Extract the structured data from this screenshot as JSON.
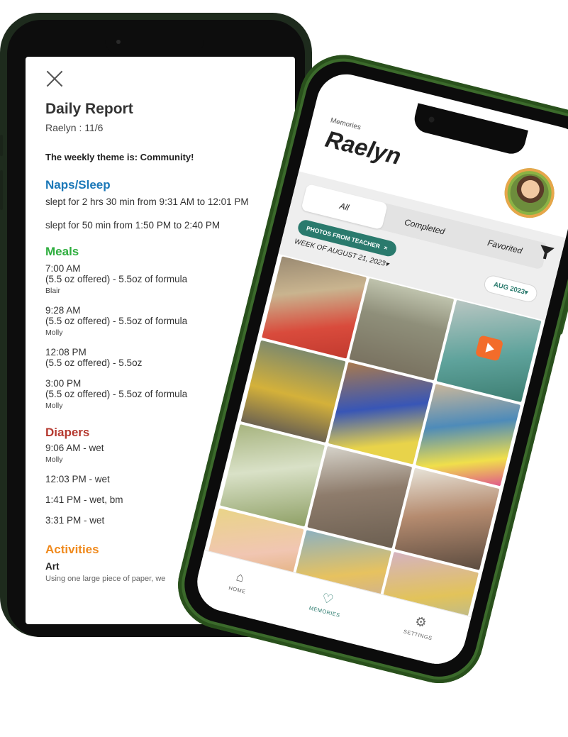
{
  "report": {
    "title": "Daily Report",
    "subtitle": "Raelyn : 11/6",
    "theme": "The weekly theme is: Community!",
    "naps": {
      "heading": "Naps/Sleep",
      "entries": [
        "slept for 2 hrs 30 min from 9:31 AM to 12:01 PM",
        "slept for 50 min from 1:50 PM to 2:40 PM"
      ]
    },
    "meals": {
      "heading": "Meals",
      "entries": [
        {
          "time": "7:00 AM",
          "detail": "(5.5 oz offered) - 5.5oz of formula",
          "by": "Blair"
        },
        {
          "time": "9:28 AM",
          "detail": "(5.5 oz offered) - 5.5oz of formula",
          "by": "Molly"
        },
        {
          "time": "12:08 PM",
          "detail": "(5.5 oz offered) - 5.5oz",
          "by": ""
        },
        {
          "time": "3:00 PM",
          "detail": "(5.5 oz offered) - 5.5oz of formula",
          "by": "Molly"
        }
      ]
    },
    "diapers": {
      "heading": "Diapers",
      "entries": [
        {
          "text": "9:06 AM - wet",
          "by": "Molly"
        },
        {
          "text": "12:03 PM - wet",
          "by": ""
        },
        {
          "text": "1:41 PM - wet, bm",
          "by": ""
        },
        {
          "text": "3:31 PM - wet",
          "by": ""
        }
      ]
    },
    "activities": {
      "heading": "Activities",
      "name": "Art",
      "desc": "Using one large piece of paper, we"
    }
  },
  "memories": {
    "label": "Memories",
    "name": "Raelyn",
    "tabs": [
      "All",
      "Completed",
      "Favorited"
    ],
    "active_tab": "All",
    "chip": "PHOTOS FROM TEACHER",
    "chip_close": "×",
    "week": "WEEK OF AUGUST 21, 2023",
    "week_caret": "▾",
    "month": "AUG 2023",
    "month_caret": "▾",
    "nav": [
      {
        "label": "HOME",
        "icon": "⌂"
      },
      {
        "label": "MEMORIES",
        "icon": "♡"
      },
      {
        "label": "SETTINGS",
        "icon": "⚙"
      }
    ]
  },
  "colors": {
    "naps": "#1b78b8",
    "meals": "#2fae3f",
    "diapers": "#b5392f",
    "activities": "#f08a1d",
    "accent": "#2a7a6d",
    "phone_body": "#3b6a2b"
  }
}
